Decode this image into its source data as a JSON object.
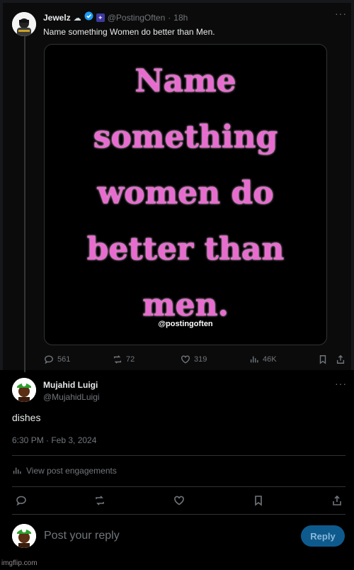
{
  "original_post": {
    "author_name": "Jewelz",
    "handle": "@PostingOften",
    "time": "18h",
    "text": "Name something Women do better than Men.",
    "image_lines": [
      "Name",
      "something",
      "women do",
      "better than",
      "men."
    ],
    "image_watermark": "@postingoften",
    "actions": {
      "replies": "561",
      "reposts": "72",
      "likes": "319",
      "views": "46K"
    }
  },
  "reply": {
    "author_name": "Mujahid Luigi",
    "handle": "@MujahidLuigi",
    "text": "dishes",
    "timestamp": "6:30 PM · Feb 3, 2024",
    "engagements_label": "View post engagements"
  },
  "composer": {
    "placeholder": "Post your reply",
    "button_label": "Reply"
  },
  "watermark": "imgflip.com",
  "colors": {
    "accent": "#1d9bf0",
    "pink_text": "#e86ccf",
    "muted": "#71767b"
  }
}
